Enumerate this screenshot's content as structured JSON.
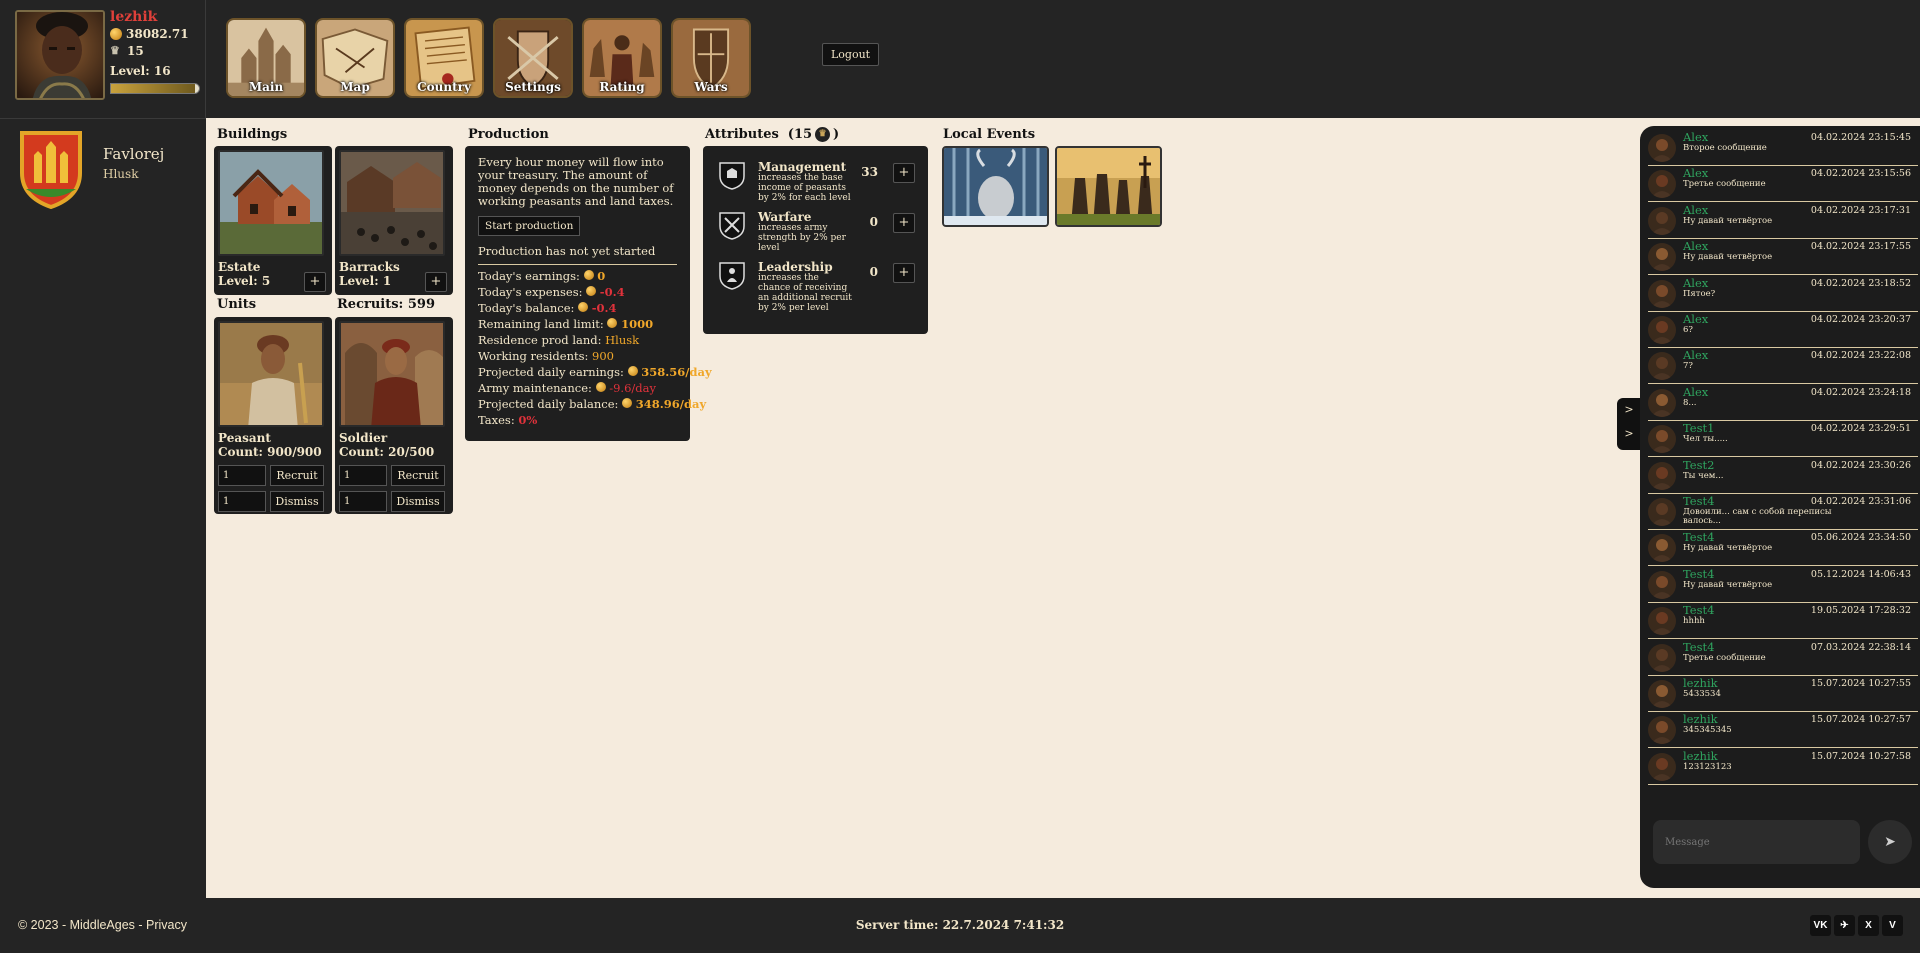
{
  "profile": {
    "username": "lezhik",
    "gold": "38082.71",
    "crowns": "15",
    "level": "Level: 16",
    "level_progress": 0.95
  },
  "nav": [
    {
      "label": "Main",
      "icon": "castle-art"
    },
    {
      "label": "Map",
      "icon": "map-art"
    },
    {
      "label": "Country",
      "icon": "scroll-art"
    },
    {
      "label": "Settings",
      "icon": "crest-art"
    },
    {
      "label": "Rating",
      "icon": "knight-art"
    },
    {
      "label": "Wars",
      "icon": "shield-art"
    }
  ],
  "logout_label": "Logout",
  "country": {
    "name": "Favlorej",
    "city": "Hlusk"
  },
  "buildings": {
    "title": "Buildings",
    "items": [
      {
        "name": "Estate",
        "level": "Level: 5",
        "add": "+"
      },
      {
        "name": "Barracks",
        "level": "Level: 1",
        "add": "+"
      }
    ]
  },
  "units": {
    "title": "Units",
    "recruits": "Recruits: 599",
    "items": [
      {
        "name": "Peasant",
        "count": "Count: 900/900",
        "recruit_value": "1",
        "dismiss_value": "1",
        "recruit_label": "Recruit",
        "dismiss_label": "Dismiss"
      },
      {
        "name": "Soldier",
        "count": "Count: 20/500",
        "recruit_value": "1",
        "dismiss_value": "1",
        "recruit_label": "Recruit",
        "dismiss_label": "Dismiss"
      }
    ]
  },
  "production": {
    "title": "Production",
    "description": "Every hour money will flow into your treasury. The amount of money depends on the number of working peasants and land taxes.",
    "start_label": "Start production",
    "status": "Production has not yet started",
    "stats": {
      "earnings_label": "Today's earnings:",
      "earnings_value": "0",
      "expenses_label": "Today's expenses:",
      "expenses_value": "-0.4",
      "balance_label": "Today's balance:",
      "balance_value": "-0.4",
      "land_label": "Remaining land limit:",
      "land_value": "1000",
      "residence_label": "Residence prod land:",
      "residence_value": "Hlusk",
      "residents_label": "Working residents:",
      "residents_value": "900",
      "proj_earn_label": "Projected daily earnings:",
      "proj_earn_value": "358.56/day",
      "army_label": "Army maintenance:",
      "army_value": "-9.6/day",
      "proj_bal_label": "Projected daily balance:",
      "proj_bal_value": "348.96/day",
      "taxes_label": "Taxes:",
      "taxes_value": "0%"
    }
  },
  "attributes": {
    "title": "Attributes",
    "points_prefix": "(15",
    "points_suffix": ")",
    "items": [
      {
        "name": "Management",
        "desc": "increases the base income of peasants by 2% for each level",
        "value": "33",
        "add": "+"
      },
      {
        "name": "Warfare",
        "desc": "increases army strength by 2% per level",
        "value": "0",
        "add": "+"
      },
      {
        "name": "Leadership",
        "desc": "increases the chance of receiving an additional recruit by 2% per level",
        "value": "0",
        "add": "+"
      }
    ]
  },
  "events": {
    "title": "Local Events"
  },
  "chat": {
    "toggle_top": ">",
    "toggle_bottom": ">",
    "placeholder": "Message",
    "send": "➤",
    "messages": [
      {
        "user": "Alex",
        "time": "04.02.2024 23:15:45",
        "text": "Второе сообщение"
      },
      {
        "user": "Alex",
        "time": "04.02.2024 23:15:56",
        "text": "Третье сообщение"
      },
      {
        "user": "Alex",
        "time": "04.02.2024 23:17:31",
        "text": "Ну давай четвёртое"
      },
      {
        "user": "Alex",
        "time": "04.02.2024 23:17:55",
        "text": "Ну давай четвёртое"
      },
      {
        "user": "Alex",
        "time": "04.02.2024 23:18:52",
        "text": "Пятое?"
      },
      {
        "user": "Alex",
        "time": "04.02.2024 23:20:37",
        "text": "6?"
      },
      {
        "user": "Alex",
        "time": "04.02.2024 23:22:08",
        "text": "7?"
      },
      {
        "user": "Alex",
        "time": "04.02.2024 23:24:18",
        "text": "8..."
      },
      {
        "user": "Test1",
        "time": "04.02.2024 23:29:51",
        "text": "Чел ты....."
      },
      {
        "user": "Test2",
        "time": "04.02.2024 23:30:26",
        "text": "Ты чем..."
      },
      {
        "user": "Test4",
        "time": "04.02.2024 23:31:06",
        "text": "Довоили... сам с собой переписы валось..."
      },
      {
        "user": "Test4",
        "time": "05.06.2024 23:34:50",
        "text": "Ну давай четвёртое"
      },
      {
        "user": "Test4",
        "time": "05.12.2024 14:06:43",
        "text": "Ну давай четвёртое"
      },
      {
        "user": "Test4",
        "time": "19.05.2024 17:28:32",
        "text": "hhhh"
      },
      {
        "user": "Test4",
        "time": "07.03.2024 22:38:14",
        "text": "Третье сообщение"
      },
      {
        "user": "lezhik",
        "time": "15.07.2024 10:27:55",
        "text": "5433534"
      },
      {
        "user": "lezhik",
        "time": "15.07.2024 10:27:57",
        "text": "345345345"
      },
      {
        "user": "lezhik",
        "time": "15.07.2024 10:27:58",
        "text": "123123123"
      }
    ]
  },
  "footer": {
    "copyright": "© 2023 - MiddleAges - Privacy",
    "server_time": "Server time: 22.7.2024 7:41:32",
    "socials": [
      {
        "label": "VK",
        "icon": "vk-icon"
      },
      {
        "label": "✈",
        "icon": "telegram-icon"
      },
      {
        "label": "X",
        "icon": "x-icon"
      },
      {
        "label": "V",
        "icon": "viber-icon"
      }
    ]
  }
}
